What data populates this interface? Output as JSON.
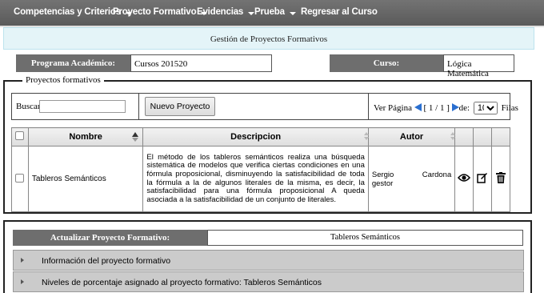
{
  "nav": {
    "items": [
      {
        "label": "Competencias y Criterios",
        "has_menu": true
      },
      {
        "label": "Proyecto Formativo",
        "has_menu": true
      },
      {
        "label": "Evidencias",
        "has_menu": true
      },
      {
        "label": "Prueba",
        "has_menu": true
      },
      {
        "label": "Regresar al Curso",
        "has_menu": false
      }
    ]
  },
  "banner": {
    "title": "Gestión de Proyectos Formativos"
  },
  "info": {
    "programa_label": "Programa Académico:",
    "programa_value": "Cursos 201520",
    "curso_label": "Curso:",
    "curso_value": "Lógica Matemática"
  },
  "projects": {
    "legend": "Proyectos formativos",
    "search_label": "Buscar:",
    "search_value": "",
    "new_button": "Nuevo Proyecto",
    "pager": {
      "page_label": "Ver Página",
      "page_indicator": "[ 1 / 1 ]",
      "de_label": "de:",
      "rows_value": "10",
      "rows_label": "Filas"
    },
    "columns": {
      "nombre": "Nombre",
      "descripcion": "Descripcion",
      "autor": "Autor"
    },
    "rows": [
      {
        "nombre": "Tableros Semánticos",
        "descripcion": "El método de los tableros semánticos realiza una búsqueda sistemática de modelos que verifica ciertas condiciones en una fórmula proposicional, disminuyendo la satisfacibilidad de toda la fórmula a la de algunos literales de la misma, es decir, la satisfacibilidad para una fórmula proposicional A queda asociada a la satisfacibilidad de un conjunto de literales.",
        "autor_first": "Sergio",
        "autor_last": "Cardona",
        "autor_role": "gestor"
      }
    ]
  },
  "update": {
    "label": "Actualizar Proyecto Formativo:",
    "value": "Tableros Semánticos",
    "sections": [
      {
        "label": "Información del proyecto formativo"
      },
      {
        "label": "Niveles de porcentaje asignado al proyecto formativo: Tableros Semánticos"
      }
    ]
  },
  "colors": {
    "nav_bg": "#666666",
    "banner_bg": "#e4f4f8",
    "label_bg": "#6e6e6e",
    "pager_arrow": "#2a6fd0"
  },
  "icons": [
    "chevron-down-icon",
    "arrow-left-icon",
    "arrow-right-icon",
    "eye-icon",
    "edit-icon",
    "trash-icon"
  ]
}
